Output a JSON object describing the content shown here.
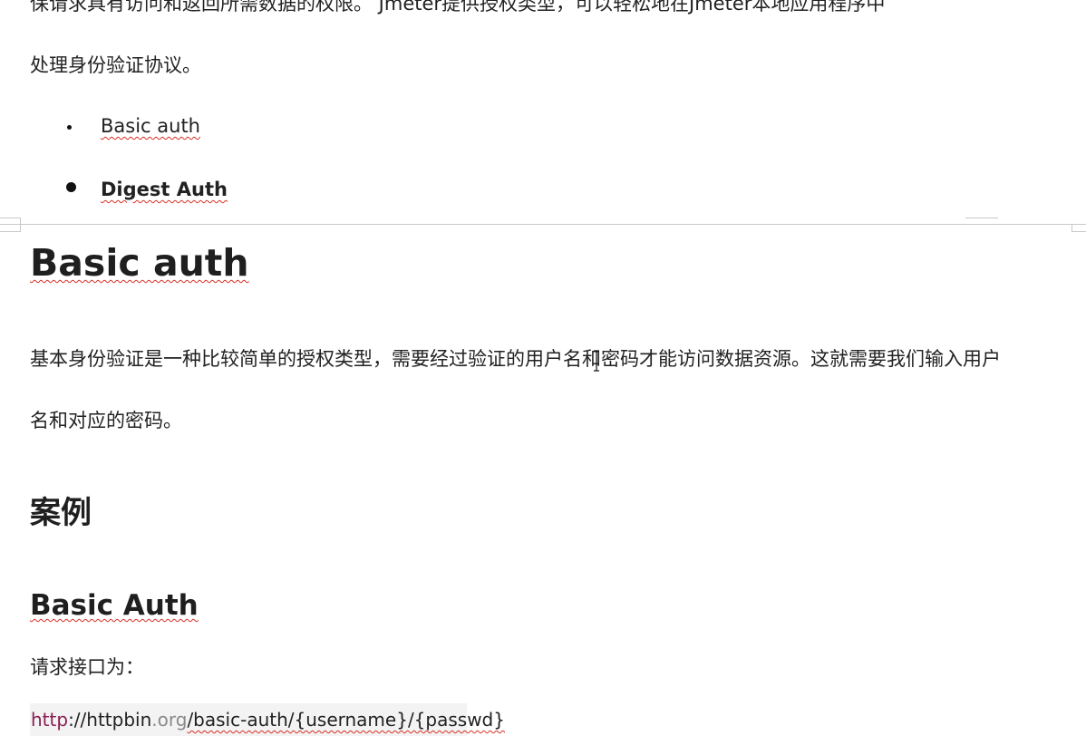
{
  "intro": {
    "line1": "保请求具有访问和返回所需数据的权限。  Jmeter提供授权类型，可以轻松地在Jmeter本地应用程序中",
    "line2": "处理身份验证协议。"
  },
  "auth_list": [
    {
      "label": "Basic auth"
    },
    {
      "label": "Digest Auth"
    }
  ],
  "basic_section": {
    "heading": "Basic auth",
    "para_line1": "基本身份验证是一种比较简单的授权类型，需要经过验证的用户名和密码才能访问数据资源。这就需要我们输入用户",
    "para_line2": "名和对应的密码。"
  },
  "example": {
    "heading": "案例",
    "subheading": "Basic Auth",
    "request_label": "请求接口为：",
    "url": {
      "scheme": "http",
      "host_prefix": "://httpbin",
      "tld": ".org",
      "path": "/basic-auth/{username}/{passwd}"
    }
  },
  "colors": {
    "text": "#222222",
    "spellcheck_underline": "#d93025",
    "url_scheme": "#8a1f54",
    "code_background": "#f3f3f3"
  }
}
